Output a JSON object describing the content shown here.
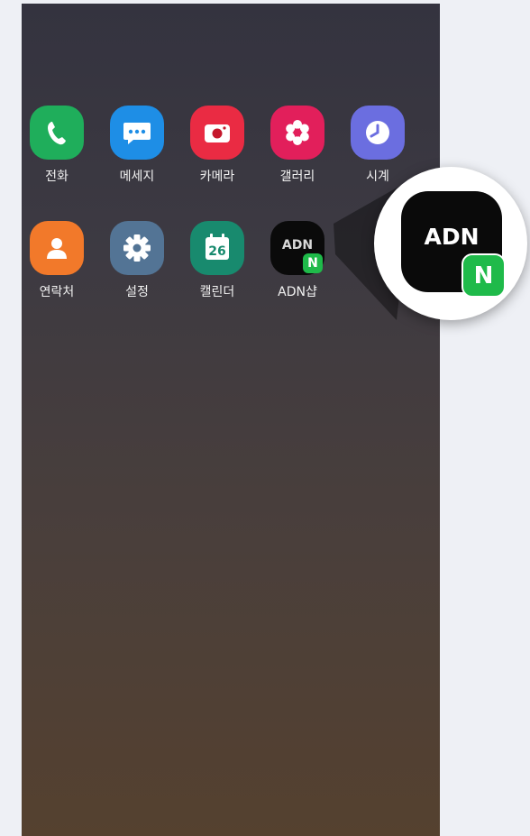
{
  "apps_row1": [
    {
      "label": "전화",
      "icon": "phone-icon"
    },
    {
      "label": "메세지",
      "icon": "message-icon"
    },
    {
      "label": "카메라",
      "icon": "camera-icon"
    },
    {
      "label": "갤러리",
      "icon": "gallery-flower-icon"
    },
    {
      "label": "시계",
      "icon": "clock-icon"
    }
  ],
  "apps_row2": [
    {
      "label": "연락처",
      "icon": "contacts-icon"
    },
    {
      "label": "설정",
      "icon": "settings-gear-icon"
    },
    {
      "label": "캘린더",
      "icon": "calendar-icon",
      "day": "26"
    },
    {
      "label": "ADN샵",
      "icon": "adn-shop-icon",
      "logo_text": "ADN",
      "badge": "N"
    }
  ],
  "zoom": {
    "logo_text": "ADN",
    "badge": "N"
  },
  "colors": {
    "phone": "#1fae5b",
    "message": "#1e8ee6",
    "camera": "#ea2b43",
    "gallery": "#e21f5b",
    "clock": "#6b6ee0",
    "contacts": "#f2792a",
    "settings": "#537495",
    "calendar": "#188a6e",
    "naver_green": "#1fba4a"
  }
}
